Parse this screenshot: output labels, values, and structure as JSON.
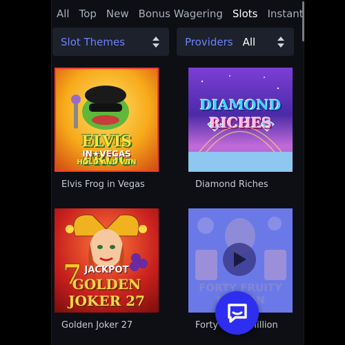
{
  "tabs": [
    "All",
    "Top",
    "New",
    "Bonus Wagering",
    "Slots",
    "Instant"
  ],
  "active_tab": "Slots",
  "filters": {
    "themes_label": "Slot Themes",
    "providers_label": "Providers",
    "providers_value": "All"
  },
  "games": [
    {
      "title": "Elvis Frog in Vegas",
      "art_line1": "ELVIS FROG",
      "art_line2": "IN★VEGAS",
      "art_line3": "HOLD AND WIN"
    },
    {
      "title": "Diamond Riches",
      "art_line1": "DIAMOND",
      "art_line2": "RICHES"
    },
    {
      "title": "Golden Joker 27",
      "art_line1": "JACKPOT",
      "art_line2": "GOLDEN",
      "art_line3": "JOKER 27"
    },
    {
      "title": "Forty Fruity Million",
      "art_line1": "FORTY FRUITY",
      "art_line2": "MILLION"
    }
  ],
  "chat": {
    "icon": "chat-bubble-icon"
  },
  "colors": {
    "accent": "#3d6cff",
    "chat_button": "#2d2ef0",
    "filter_label": "#6b83ff"
  }
}
